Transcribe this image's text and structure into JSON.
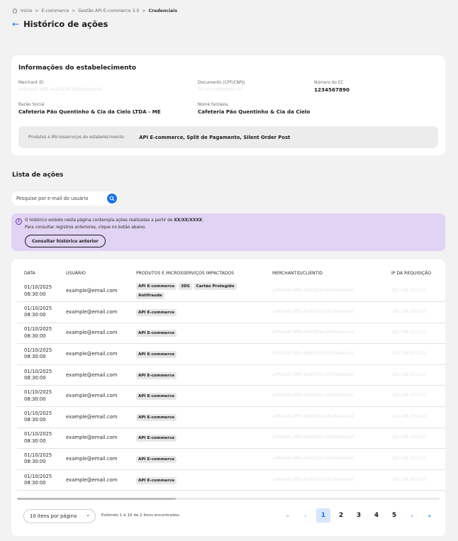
{
  "breadcrumb": {
    "home": "Início",
    "items": [
      "E-commerce",
      "Gestão API E-commerce 3.0"
    ],
    "current": "Credenciais",
    "separator": ">"
  },
  "page": {
    "back_icon": "←",
    "title": "Histórico de ações"
  },
  "establishment": {
    "section_title": "Informações do estabelecimento",
    "merchant_id_label": "Merchant ID",
    "merchant_id_value": "a0f63e45-8ff6-46df-82fb-035dfa64ce42",
    "document_label": "Documento (CPF/CNPJ)",
    "document_value": "00.000.PHM/0001-94",
    "ec_number_label": "Número do EC",
    "ec_number_value": "1234567890",
    "legal_name_label": "Razão Social",
    "legal_name_value": "Cafeteria Pão Quentinho & Cia da Cielo LTDA - ME",
    "trade_name_label": "Nome fantasia",
    "trade_name_value": "Cafeteria Pão Quentinho & Cia da Cielo",
    "products_label": "Produtos e Microsserviços do estabelecimento:",
    "products_value": "API E-commerce, Split de Pagamento, Silent Order Post"
  },
  "actions": {
    "section_title": "Lista de ações",
    "search_placeholder": "Pesquise por e-mail do usuário",
    "notice": {
      "line1_prefix": "O histórico exibido nesta página contempla ações realizadas a partir de ",
      "line1_date": "XX/XX/XXXX",
      "line1_suffix": ".",
      "line2": "Para consultar registros anteriores, clique no botão abaixo.",
      "button": "Consultar histórico anterior"
    },
    "columns": [
      "DATA",
      "USUÁRIO",
      "PRODUTOS E MICROSSERVIÇOS IMPACTADOS",
      "MERCHANTID/CLIENTID",
      "IP DA REQUISIÇÃO"
    ],
    "rows": [
      {
        "date": "01/10/2025",
        "time": "08:30:00",
        "user": "example@email.com",
        "tags": [
          "API E-commerce",
          "3DS",
          "Cartão Protegido",
          "Antifraude"
        ],
        "merchant": "a0f63e45-8ff6-46df-82fb-035dfa64ce42",
        "ip": "192.168.255.255"
      },
      {
        "date": "01/10/2025",
        "time": "08:30:00",
        "user": "example@email.com",
        "tags": [
          "API E-commerce"
        ],
        "merchant": "a0f63e45-8ff6-46df-82fb-035dfa64ce42",
        "ip": "192.168.255.255"
      },
      {
        "date": "01/10/2025",
        "time": "08:30:00",
        "user": "example@email.com",
        "tags": [
          "API E-commerce"
        ],
        "merchant": "a0f63e45-8ff6-46df-82fb-035dfa64ce42",
        "ip": "192.168.255.255"
      },
      {
        "date": "01/10/2025",
        "time": "08:30:00",
        "user": "example@email.com",
        "tags": [
          "API E-commerce"
        ],
        "merchant": "a0f63e45-8ff6-46df-82fb-035dfa64ce42",
        "ip": "192.168.255.255"
      },
      {
        "date": "01/10/2025",
        "time": "08:30:00",
        "user": "example@email.com",
        "tags": [
          "API E-commerce"
        ],
        "merchant": "a0f63e45-8ff6-46df-82fb-035dfa64ce42",
        "ip": "192.168.255.255"
      },
      {
        "date": "01/10/2025",
        "time": "08:30:00",
        "user": "example@email.com",
        "tags": [
          "API E-commerce"
        ],
        "merchant": "a0f63e45-8ff6-46df-82fb-035dfa64ce42",
        "ip": "192.168.255.255"
      },
      {
        "date": "01/10/2025",
        "time": "08:30:00",
        "user": "example@email.com",
        "tags": [
          "API E-commerce"
        ],
        "merchant": "a0f63e45-8ff6-46df-82fb-035dfa64ce42",
        "ip": "192.168.255.255"
      },
      {
        "date": "01/10/2025",
        "time": "08:30:00",
        "user": "example@email.com",
        "tags": [
          "API E-commerce"
        ],
        "merchant": "a0f63e45-8ff6-46df-82fb-035dfa64ce42",
        "ip": "192.168.255.255"
      },
      {
        "date": "01/10/2025",
        "time": "08:30:00",
        "user": "example@email.com",
        "tags": [
          "API E-commerce"
        ],
        "merchant": "a0f63e45-8ff6-46df-82fb-035dfa64ce42",
        "ip": "192.168.255.255"
      },
      {
        "date": "01/10/2025",
        "time": "08:30:00",
        "user": "example@email.com",
        "tags": [
          "API E-commerce"
        ],
        "merchant": "a0f63e45-8ff6-46df-82fb-035dfa64ce42",
        "ip": "192.168.255.255"
      }
    ],
    "per_page": "10 itens por página",
    "found_text": "Exibindo 1 à 10 de 2 itens encontrados.",
    "pages": [
      "1",
      "2",
      "3",
      "4",
      "5"
    ],
    "active_page": "1",
    "nav": {
      "first": "«",
      "prev": "‹",
      "next": "›",
      "last": "»"
    }
  },
  "colors": {
    "accent": "#1a73e8",
    "notice_bg": "#e1d3f4",
    "page_bg": "#f2f2f2"
  },
  "icons": [
    "home-icon",
    "back-arrow-icon",
    "search-icon",
    "info-icon",
    "chevron-down-icon"
  ]
}
